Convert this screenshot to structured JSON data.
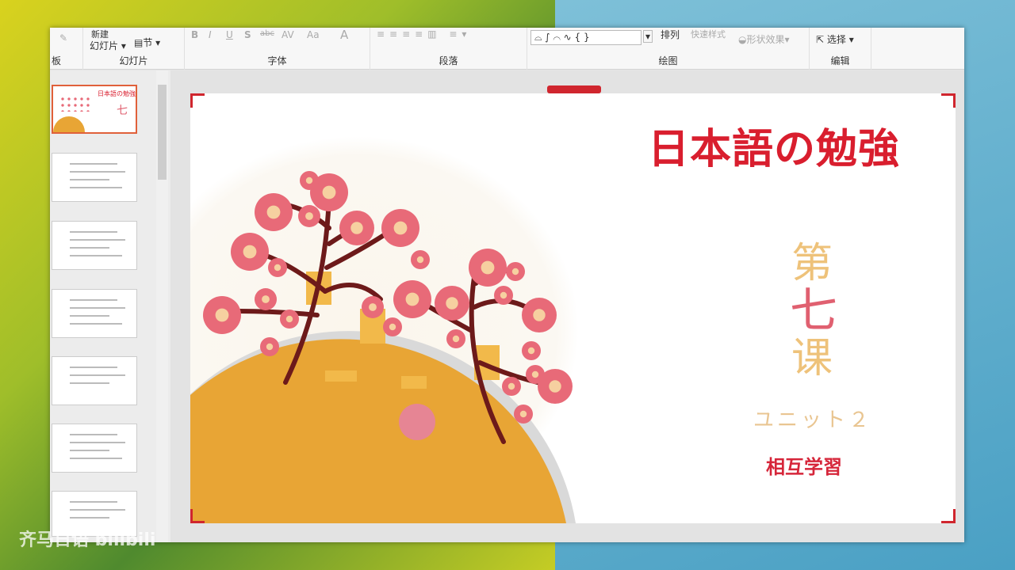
{
  "ribbon": {
    "clipboard": {
      "label": "板"
    },
    "slides": {
      "new_slide_top": "新建",
      "new_slide": "幻灯片",
      "section": "节",
      "label": "幻灯片"
    },
    "font": {
      "bold": "B",
      "italic": "I",
      "underline": "U",
      "shadow": "S",
      "strike": "abc",
      "spacing": "AV",
      "case": "Aa",
      "color": "A",
      "label": "字体"
    },
    "paragraph": {
      "label": "段落"
    },
    "drawing": {
      "shapes": "⌓ ∫ ⌒ ∿ { }",
      "arrange": "排列",
      "quick_styles": "快速样式",
      "shape_effects": "形状效果",
      "label": "绘图"
    },
    "editing": {
      "select": "选择",
      "label": "编辑"
    }
  },
  "slide": {
    "title": "日本語の勉強",
    "lesson": [
      "第",
      "七",
      "课"
    ],
    "unit": "ユニット２",
    "subtitle": "相互学習"
  },
  "thumbnails": {
    "selected_index": 0,
    "count": 7,
    "first_title": "日本語の勉強",
    "first_mark": "七"
  },
  "watermark": "齐马日语 bilibili",
  "colors": {
    "accent": "#d91e2e",
    "hill": "#e8a535",
    "blossom": "#e86a78"
  }
}
